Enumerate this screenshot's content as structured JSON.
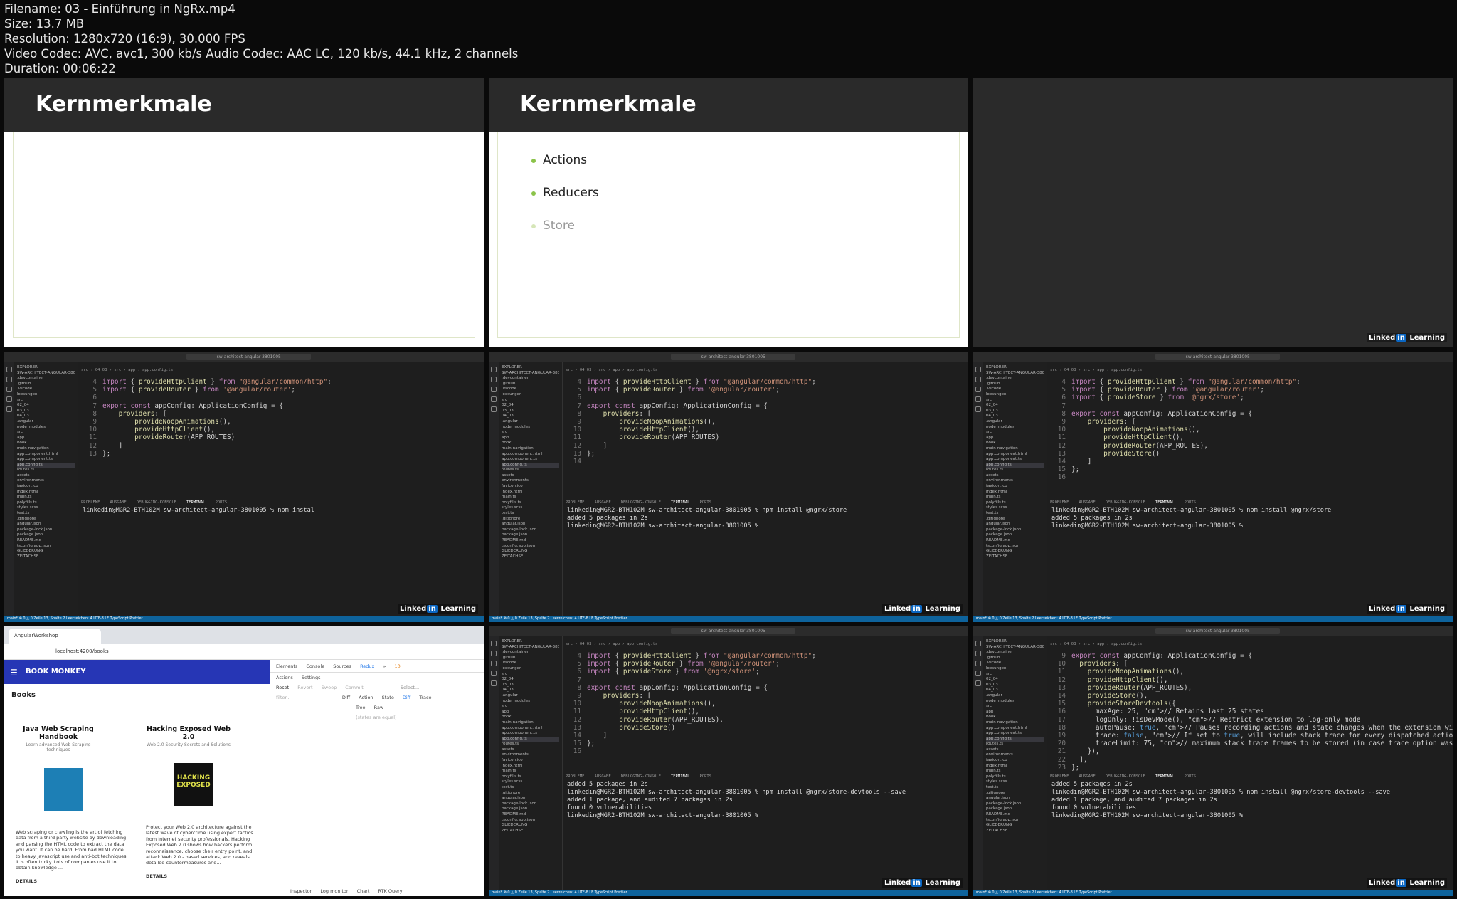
{
  "file_info": [
    "Filename: 03 - Einführung in NgRx.mp4",
    "Size: 13.7 MB",
    "Resolution: 1280x720 (16:9), 30.000 FPS",
    "Video Codec: AVC, avc1, 300 kb/s Audio Codec: AAC LC, 120 kb/s, 44.1 kHz, 2 channels",
    "Duration: 00:06:22"
  ],
  "slides": {
    "title": "Kernmerkmale",
    "bullets": [
      "Actions",
      "Reducers",
      "Store"
    ],
    "brand_left": "Linked",
    "brand_mid": "in",
    "brand_right": "Learning"
  },
  "vscode": {
    "search": "sw-architect-angular-3801005",
    "breadcrumb": "src › 04_03 › src › app › app.config.ts",
    "status": "main* ⊗ 0 △ 0    Zeile 13, Spalte 2   Leerzeichen: 4   UTF-8   LF   TypeScript   Prettier",
    "panel_tabs": [
      "PROBLEME",
      "AUSGABE",
      "DEBUGGING-KONSOLE",
      "TERMINAL",
      "PORTS"
    ],
    "explorer": [
      "EXPLORER",
      "SW-ARCHITECT-ANGULAR-3801005",
      ".devcontainer",
      ".github",
      ".vscode",
      "loesungen",
      "src",
      "02_04",
      "03_03",
      "04_03",
      ".angular",
      "node_modules",
      "src",
      "app",
      "book",
      "main-navigation",
      "app.component.html",
      "app.component.ts",
      "app.config.ts",
      "routes.ts",
      "assets",
      "environments",
      "favicon.ico",
      "index.html",
      "main.ts",
      "polyfills.ts",
      "styles.scss",
      "test.ts",
      ".gitignore",
      "angular.json",
      "package-lock.json",
      "package.json",
      "README.md",
      "tsconfig.app.json",
      "GLIEDERUNG",
      "ZEITACHSE"
    ],
    "prompt": "linkedin@MGR2-BTH102M sw-architect-angular-3801005 %"
  },
  "screens": [
    {
      "start": 4,
      "lines": [
        "import { provideHttpClient } from \"@angular/common/http\";",
        "import { provideRouter } from '@angular/router';",
        "",
        "export const appConfig: ApplicationConfig = {",
        "    providers: [",
        "        provideNoopAnimations(),",
        "        provideHttpClient(),",
        "        provideRouter(APP_ROUTES)",
        "    ]",
        "};"
      ],
      "term": [
        "linkedin@MGR2-BTH102M sw-architect-angular-3801005 % npm instal"
      ]
    },
    {
      "start": 4,
      "lines": [
        "import { provideHttpClient } from \"@angular/common/http\";",
        "import { provideRouter } from '@angular/router';",
        "",
        "export const appConfig: ApplicationConfig = {",
        "    providers: [",
        "        provideNoopAnimations(),",
        "        provideHttpClient(),",
        "        provideRouter(APP_ROUTES)",
        "    ]",
        "};",
        ""
      ],
      "term": [
        "linkedin@MGR2-BTH102M sw-architect-angular-3801005 % npm install @ngrx/store",
        "",
        "added 5 packages in 2s",
        "linkedin@MGR2-BTH102M sw-architect-angular-3801005 % "
      ]
    },
    {
      "start": 4,
      "lines": [
        "import { provideHttpClient } from \"@angular/common/http\";",
        "import { provideRouter } from '@angular/router';",
        "import { provideStore } from '@ngrx/store';",
        "",
        "export const appConfig: ApplicationConfig = {",
        "    providers: [",
        "        provideNoopAnimations(),",
        "        provideHttpClient(),",
        "        provideRouter(APP_ROUTES),",
        "        provideStore()",
        "    ]",
        "};",
        ""
      ],
      "term": [
        "linkedin@MGR2-BTH102M sw-architect-angular-3801005 % npm install @ngrx/store",
        "",
        "added 5 packages in 2s",
        "linkedin@MGR2-BTH102M sw-architect-angular-3801005 % "
      ]
    },
    {
      "start": 4,
      "lines": [
        "import { provideHttpClient } from \"@angular/common/http\";",
        "import { provideRouter } from '@angular/router';",
        "import { provideStore } from '@ngrx/store';",
        "",
        "export const appConfig: ApplicationConfig = {",
        "    providers: [",
        "        provideNoopAnimations(),",
        "        provideHttpClient(),",
        "        provideRouter(APP_ROUTES),",
        "        provideStore()",
        "    ]",
        "};",
        ""
      ],
      "term": [
        "added 5 packages in 2s",
        "linkedin@MGR2-BTH102M sw-architect-angular-3801005 % npm install @ngrx/store-devtools --save",
        "",
        "added 1 package, and audited 7 packages in 2s",
        "",
        "found 0 vulnerabilities",
        "linkedin@MGR2-BTH102M sw-architect-angular-3801005 % "
      ]
    },
    {
      "start": 9,
      "lines": [
        "export const appConfig: ApplicationConfig = {",
        "  providers: [",
        "    provideNoopAnimations(),",
        "    provideHttpClient(),",
        "    provideRouter(APP_ROUTES),",
        "    provideStore(),",
        "    provideStoreDevtools({",
        "      maxAge: 25, // Retains last 25 states",
        "      logOnly: !isDevMode(), // Restrict extension to log-only mode",
        "      autoPause: true, // Pauses recording actions and state changes when the extension wind",
        "      trace: false, // If set to true, will include stack trace for every dispatched action,",
        "      traceLimit: 75, // maximum stack trace frames to be stored (in case trace option was p",
        "    }),",
        "  ],",
        "};"
      ],
      "term": [
        "added 5 packages in 2s",
        "linkedin@MGR2-BTH102M sw-architect-angular-3801005 % npm install @ngrx/store-devtools --save",
        "",
        "added 1 package, and audited 7 packages in 2s",
        "",
        "found 0 vulnerabilities",
        "linkedin@MGR2-BTH102M sw-architect-angular-3801005 % "
      ]
    }
  ],
  "browser": {
    "tab": "AngularWorkshop",
    "url": "localhost:4200/books",
    "app_title": "BOOK MONKEY",
    "section": "Books",
    "books": [
      {
        "title": "Java Web Scraping Handbook",
        "subtitle": "Learn advanced Web Scraping techniques",
        "desc": "Web scraping or crawling is the art of fetching data from a third party website by downloading and parsing the HTML code to extract the data you want. It can be hard. From bad HTML code to heavy Javascript use and anti-bot techniques, it is often tricky. Lots of companies use it to obtain knowledge ...",
        "details": "DETAILS"
      },
      {
        "title": "Hacking Exposed Web 2.0",
        "subtitle": "Web 2.0 Security Secrets and Solutions",
        "desc": "Protect your Web 2.0 architecture against the latest wave of cybercrime using expert tactics from Internet security professionals. Hacking Exposed Web 2.0 shows how hackers perform reconnaissance, choose their entry point, and attack Web 2.0 - based services, and reveals detailed countermeasures and...",
        "details": "DETAILS",
        "cover": "HACKING EXPOSED"
      }
    ],
    "devtools_tabs": [
      "Elements",
      "Console",
      "Sources",
      "Redux",
      "»"
    ],
    "redux_tabs": [
      "Actions",
      "Settings"
    ],
    "redux_controls": [
      "Reset",
      "Revert",
      "Sweep",
      "Commit"
    ],
    "select": "Select...",
    "filter": "filter...",
    "views": [
      "Diff",
      "Action",
      "State",
      "Diff",
      "Trace"
    ],
    "tree": [
      "Tree",
      "Raw"
    ],
    "empty": "(states are equal)",
    "bottom": [
      "Inspector",
      "Log monitor",
      "Chart",
      "RTK Query"
    ],
    "warn": "10"
  }
}
